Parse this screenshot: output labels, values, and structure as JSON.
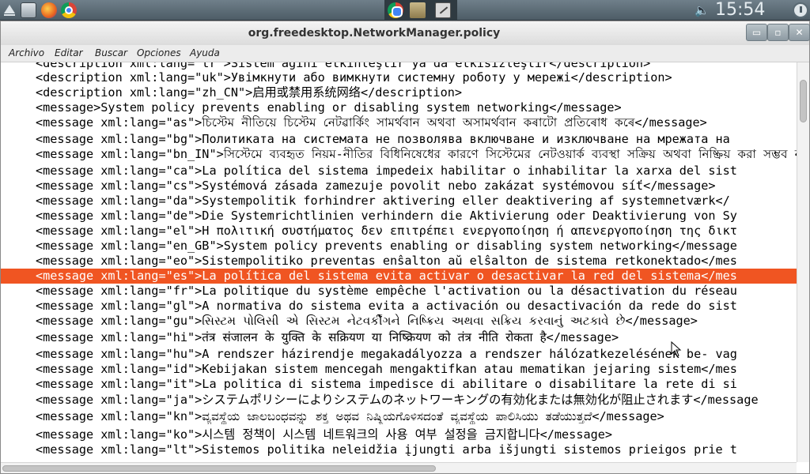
{
  "panel": {
    "clock": "15:54",
    "launchers": [
      "menu-icon",
      "files-icon",
      "firefox-icon",
      "chrome-icon"
    ],
    "tasks": [
      "chrome-icon",
      "folder-icon",
      "text-editor-icon"
    ],
    "tray": [
      "volume-icon",
      "power-icon"
    ]
  },
  "window": {
    "title": "org.freedesktop.NetworkManager.policy",
    "controls": {
      "minimize": "▭",
      "maximize": "▫",
      "close": "✕"
    }
  },
  "menubar": {
    "archivo": "Archivo",
    "editar": "Editar",
    "buscar": "Buscar",
    "opciones": "Opciones",
    "ayuda": "Ayuda"
  },
  "editor": {
    "selected_index": 14,
    "selection_color": "#f05522",
    "lines": [
      "<description xml:lang=\"tr\">Sistem ağını etkinleştir ya da etkisizleştir</description>",
      "<description xml:lang=\"uk\">Увімкнути або вимкнути системну роботу у мережі</description>",
      "<description xml:lang=\"zh_CN\">启用或禁用系统网络</description>",
      "<message>System policy prevents enabling or disabling system networking</message>",
      "<message xml:lang=\"as\">চিস্টেম নীতিয়ে চিস্টেম নেটৱাৰ্কিং সামৰ্থবান অথবা অসামৰ্থবান কৰাটো প্ৰতিৰোধ কৰে</message>",
      "<message xml:lang=\"bg\">Политиката на системата не позволява включване и изключване на мрежата на",
      "<message xml:lang=\"bn_IN\">সিস্টেমে ব্যবহৃত নিয়ম-নীতির বিধিনিষেধের কারণে সিস্টেমের নেটওয়ার্ক ব্যবস্থা সক্রিয় অথবা নিষ্ক্রিয় করা সম্ভব না",
      "<message xml:lang=\"ca\">La política del sistema impedeix habilitar o inhabilitar la xarxa del sist",
      "<message xml:lang=\"cs\">Systémová zásada zamezuje povolit nebo zakázat systémovou síť</message>",
      "<message xml:lang=\"da\">Systempolitik forhindrer aktivering eller deaktivering af systemnetværk</",
      "<message xml:lang=\"de\">Die Systemrichtlinien verhindern die Aktivierung oder Deaktivierung von Sy",
      "<message xml:lang=\"el\">Η πολιτική συστήματος δεν επιτρέπει ενεργοποίηση ή απενεργοποίηση της δικτ",
      "<message xml:lang=\"en_GB\">System policy prevents enabling or disabling system networking</message",
      "<message xml:lang=\"eo\">Sistempolitiko preventas enŝalton aŭ elŝalton de sistema retkonektado</mes",
      "<message xml:lang=\"es\">La política del sistema evita activar o desactivar la red del sistema</mes",
      "<message xml:lang=\"fr\">La politique du système empêche l'activation ou la désactivation du réseau",
      "<message xml:lang=\"gl\">A normativa do sistema evita a activación ou desactivación da rede do sist",
      "<message xml:lang=\"gu\">સિસ્ટમ પોલિસી એ સિસ્ટમ નેટવર્કીંગને નિષ્ક્રિય અથવા સક્રિય કરવાનું અટકાવે છે</message>",
      "<message xml:lang=\"hi\">तंत्र संजालन के युक्ति के सक्रियण या निष्क्रियण को तंत्र नीति रोकता है</message>",
      "<message xml:lang=\"hu\">A rendszer házirendje megakadályozza a rendszer hálózatkezelésének be- vag",
      "<message xml:lang=\"id\">Kebijakan sistem mencegah mengaktifkan atau mematikan jejaring sistem</mes",
      "<message xml:lang=\"it\">La politica di sistema impedisce di abilitare o disabilitare la rete di si",
      "<message xml:lang=\"ja\">システムポリシーによりシステムのネットワーキングの有効化または無効化が阻止されます</message",
      "<message xml:lang=\"kn\">ವ್ಯವಸ್ಥೆಯ ಜಾಲಬಂಧವನ್ನು ಶಕ್ತ ಅಥವ ನಿಷ್ಕ್ರಿಯಗೊಳಿಸದಂತೆ ವ್ಯವಸ್ಥೆಯ ಪಾಲಿಸಿಯು ತಡೆಯುತ್ತದೆ</message>",
      "<message xml:lang=\"ko\">시스템 정책이 시스템 네트워크의 사용 여부 설정을 금지합니다</message>",
      "<message xml:lang=\"lt\">Sistemos politika neleidžia įjungti arba išjungti sistemos prieigos prie t"
    ]
  }
}
